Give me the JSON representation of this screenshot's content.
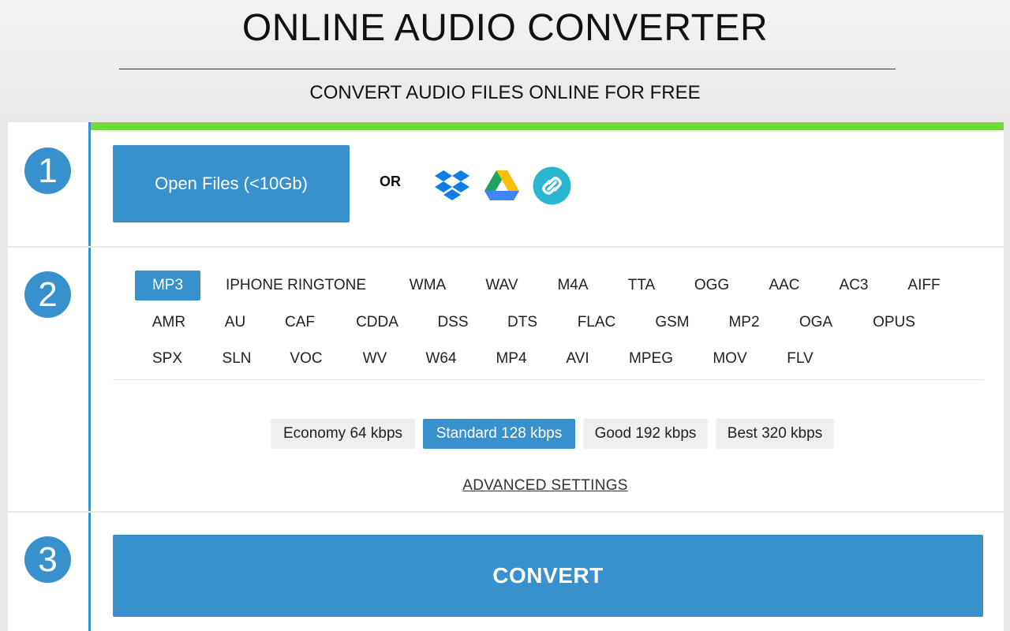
{
  "header": {
    "title": "ONLINE AUDIO CONVERTER",
    "subtitle": "CONVERT AUDIO FILES ONLINE FOR FREE"
  },
  "steps": [
    "1",
    "2",
    "3"
  ],
  "step1": {
    "open_label": "Open Files (<10Gb)",
    "or_label": "OR",
    "sources": [
      "dropbox-icon",
      "google-drive-icon",
      "url-link-icon"
    ]
  },
  "step2": {
    "formats": [
      [
        "MP3",
        "IPHONE RINGTONE",
        "WMA",
        "WAV",
        "M4A",
        "TTA",
        "OGG",
        "AAC",
        "AC3",
        "AIFF"
      ],
      [
        "AMR",
        "AU",
        "CAF",
        "CDDA",
        "DSS",
        "DTS",
        "FLAC",
        "GSM",
        "MP2",
        "OGA",
        "OPUS"
      ],
      [
        "SPX",
        "SLN",
        "VOC",
        "WV",
        "W64",
        "MP4",
        "AVI",
        "MPEG",
        "MOV",
        "FLV"
      ]
    ],
    "selected_format": "MP3",
    "qualities": [
      "Economy 64 kbps",
      "Standard 128 kbps",
      "Good 192 kbps",
      "Best 320 kbps"
    ],
    "selected_quality": "Standard 128 kbps",
    "advanced_label": "ADVANCED SETTINGS"
  },
  "step3": {
    "convert_label": "CONVERT"
  },
  "colors": {
    "accent": "#3890cc",
    "progress": "#70da36"
  }
}
